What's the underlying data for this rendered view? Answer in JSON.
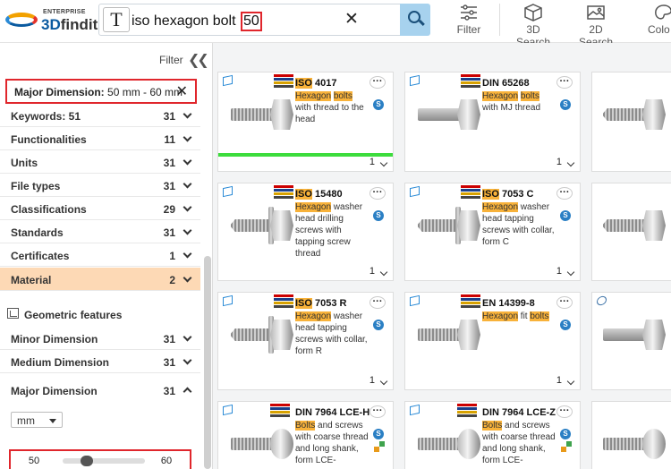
{
  "header": {
    "logo_sub": "ENTERPRISE",
    "logo_main_a": "3D",
    "logo_main_b": "findit",
    "search_text": "iso hexagon bolt",
    "search_number": "50",
    "search_type_icon": "text-type-icon",
    "tools": [
      {
        "label": "Filter",
        "icon": "sliders-icon"
      },
      {
        "label": "3D Search",
        "icon": "cube-icon"
      },
      {
        "label": "2D Search",
        "icon": "image-icon"
      },
      {
        "label": "Colo",
        "icon": "palette-icon"
      }
    ]
  },
  "sidebar": {
    "filter_label": "Filter",
    "active_filter": {
      "name": "Major Dimension:",
      "value": "50 mm - 60 mm"
    },
    "facets": [
      {
        "label": "Keywords: 51",
        "count": "31"
      },
      {
        "label": "Functionalities",
        "count": "11"
      },
      {
        "label": "Units",
        "count": "31"
      },
      {
        "label": "File types",
        "count": "31"
      },
      {
        "label": "Classifications",
        "count": "29"
      },
      {
        "label": "Standards",
        "count": "31"
      },
      {
        "label": "Certificates",
        "count": "1"
      },
      {
        "label": "Material",
        "count": "2"
      }
    ],
    "geometric_label": "Geometric features",
    "geo_facets": [
      {
        "label": "Minor Dimension",
        "count": "31"
      },
      {
        "label": "Medium Dimension",
        "count": "31"
      },
      {
        "label": "Major Dimension",
        "count": "31"
      }
    ],
    "unit": "mm",
    "range_min": "50",
    "range_max": "60",
    "range_fraction": 0.25
  },
  "results": [
    {
      "std_prefix": "ISO",
      "std_rest": " 4017",
      "desc_parts": [
        "Hexagon",
        " ",
        "bolts",
        " with thread to the head"
      ],
      "count": "1"
    },
    {
      "std_prefix": "DIN 65268",
      "std_rest": "",
      "desc_parts": [
        "Hexagon",
        " ",
        "bolts",
        " with MJ thread"
      ],
      "count": "1"
    },
    {
      "std_prefix": "ISO",
      "std_rest": " 15480",
      "desc_parts": [
        "Hexagon",
        " washer head drilling screws with tapping screw thread"
      ],
      "count": "1"
    },
    {
      "std_prefix": "ISO",
      "std_rest": " 7053 C",
      "desc_parts": [
        "Hexagon",
        " washer head tapping screws with collar, form C"
      ],
      "count": "1"
    },
    {
      "std_prefix": "ISO",
      "std_rest": " 7053 R",
      "desc_parts": [
        "Hexagon",
        " washer head tapping screws with collar, form R"
      ],
      "count": "1"
    },
    {
      "std_prefix": "EN 14399-8",
      "std_rest": "",
      "desc_parts": [
        "Hexagon",
        " fit ",
        "bolts"
      ],
      "count": "1"
    },
    {
      "std_prefix": "DIN 7964 LCE-H",
      "std_rest": "",
      "desc_parts": [
        "Bolts",
        " and screws with coarse thread and long shank, form LCE-"
      ],
      "count": ""
    },
    {
      "std_prefix": "DIN 7964 LCE-Z",
      "std_rest": "",
      "desc_parts": [
        "Bolts",
        " and screws with coarse thread and long shank, form LCE-"
      ],
      "count": ""
    }
  ],
  "colors": {
    "accent": "#0a5aa0",
    "highlight": "#f8b23a",
    "active_facet": "#fdd9b5",
    "red_box": "#e0262c",
    "green_bar": "#3cdc3c"
  }
}
